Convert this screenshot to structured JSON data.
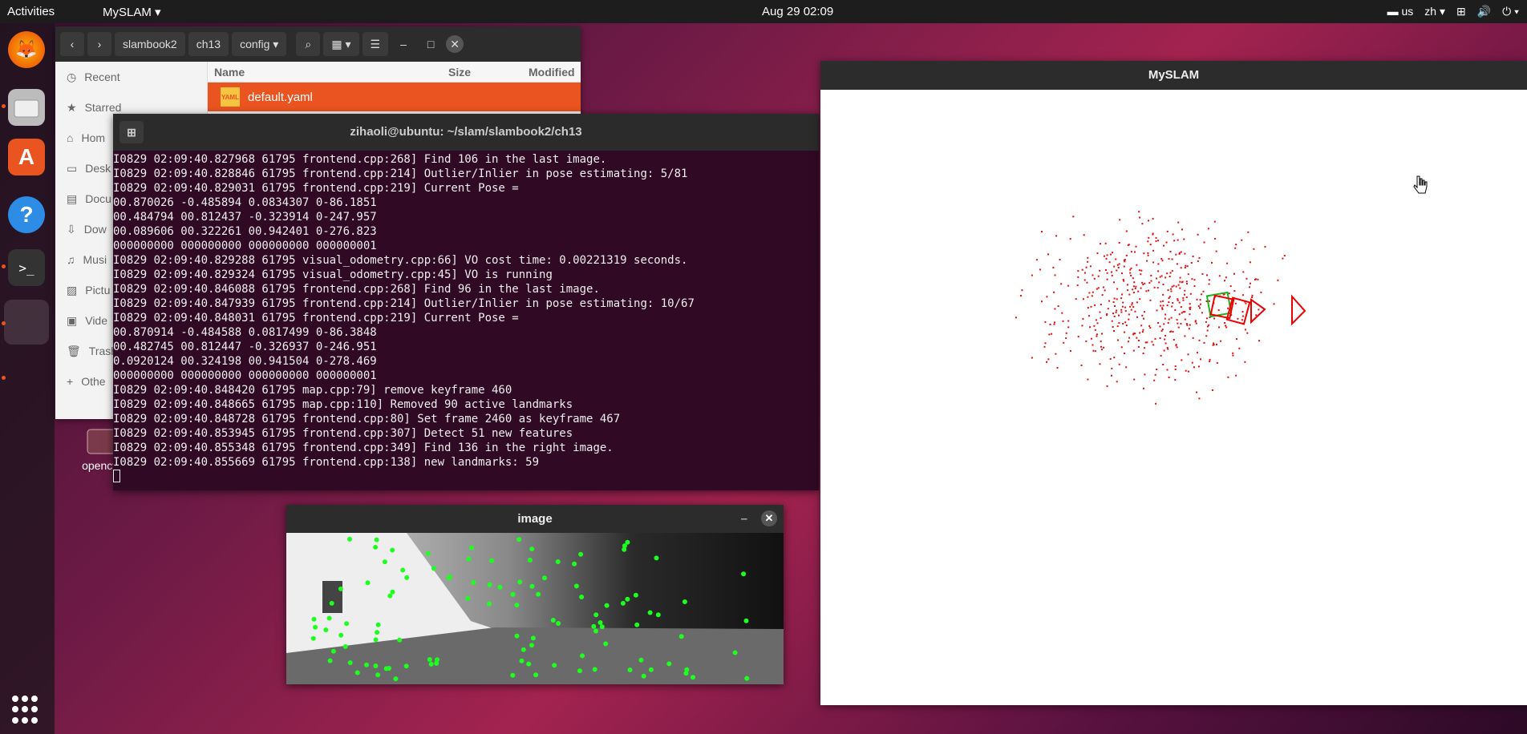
{
  "topbar": {
    "activities": "Activities",
    "app_menu": "MySLAM ▾",
    "clock": "Aug 29  02:09",
    "keyboard": "us",
    "language": "zh ▾",
    "network_icon": "network-icon",
    "volume_icon": "volume-icon",
    "power_icon": "power-icon"
  },
  "dock": {
    "items": [
      "firefox-icon",
      "files-icon",
      "software-icon",
      "help-icon",
      "terminal-icon",
      "active-app-icon"
    ],
    "show_apps": "show-applications-icon"
  },
  "files_window": {
    "breadcrumb": [
      "slambook2",
      "ch13",
      "config"
    ],
    "sidebar": [
      "Recent",
      "Starred",
      "Hom",
      "Desk",
      "Docu",
      "Dow",
      "Musi",
      "Pictu",
      "Vide",
      "Trash",
      "Othe"
    ],
    "columns": {
      "name": "Name",
      "size": "Size",
      "modified": "Modified"
    },
    "selected_file": "default.yaml",
    "file_icon_text": "YAML"
  },
  "desktop_icon": {
    "label": "opencv-"
  },
  "terminal": {
    "title": "zihaoli@ubuntu: ~/slam/slambook2/ch13",
    "lines": [
      "I0829 02:09:40.827968 61795 frontend.cpp:268] Find 106 in the last image.",
      "I0829 02:09:40.828846 61795 frontend.cpp:214] Outlier/Inlier in pose estimating: 5/81",
      "I0829 02:09:40.829031 61795 frontend.cpp:219] Current Pose =",
      "00.870026 -0.485894 0.0834307 0-86.1851",
      "00.484794 00.812437 -0.323914 0-247.957",
      "00.089606 00.322261 00.942401 0-276.823",
      "000000000 000000000 000000000 000000001",
      "I0829 02:09:40.829288 61795 visual_odometry.cpp:66] VO cost time: 0.00221319 seconds.",
      "I0829 02:09:40.829324 61795 visual_odometry.cpp:45] VO is running",
      "I0829 02:09:40.846088 61795 frontend.cpp:268] Find 96 in the last image.",
      "I0829 02:09:40.847939 61795 frontend.cpp:214] Outlier/Inlier in pose estimating: 10/67",
      "I0829 02:09:40.848031 61795 frontend.cpp:219] Current Pose =",
      "00.870914 -0.484588 0.0817499 0-86.3848",
      "00.482745 00.812447 -0.326937 0-246.951",
      "0.0920124 00.324198 00.941504 0-278.469",
      "000000000 000000000 000000000 000000001",
      "I0829 02:09:40.848420 61795 map.cpp:79] remove keyframe 460",
      "I0829 02:09:40.848665 61795 map.cpp:110] Removed 90 active landmarks",
      "I0829 02:09:40.848728 61795 frontend.cpp:80] Set frame 2460 as keyframe 467",
      "I0829 02:09:40.853945 61795 frontend.cpp:307] Detect 51 new features",
      "I0829 02:09:40.855348 61795 frontend.cpp:349] Find 136 in the right image.",
      "I0829 02:09:40.855669 61795 frontend.cpp:138] new landmarks: 59"
    ]
  },
  "myslam_window": {
    "title": "MySLAM"
  },
  "image_window": {
    "title": "image",
    "minimize": "–",
    "close": "✕"
  }
}
